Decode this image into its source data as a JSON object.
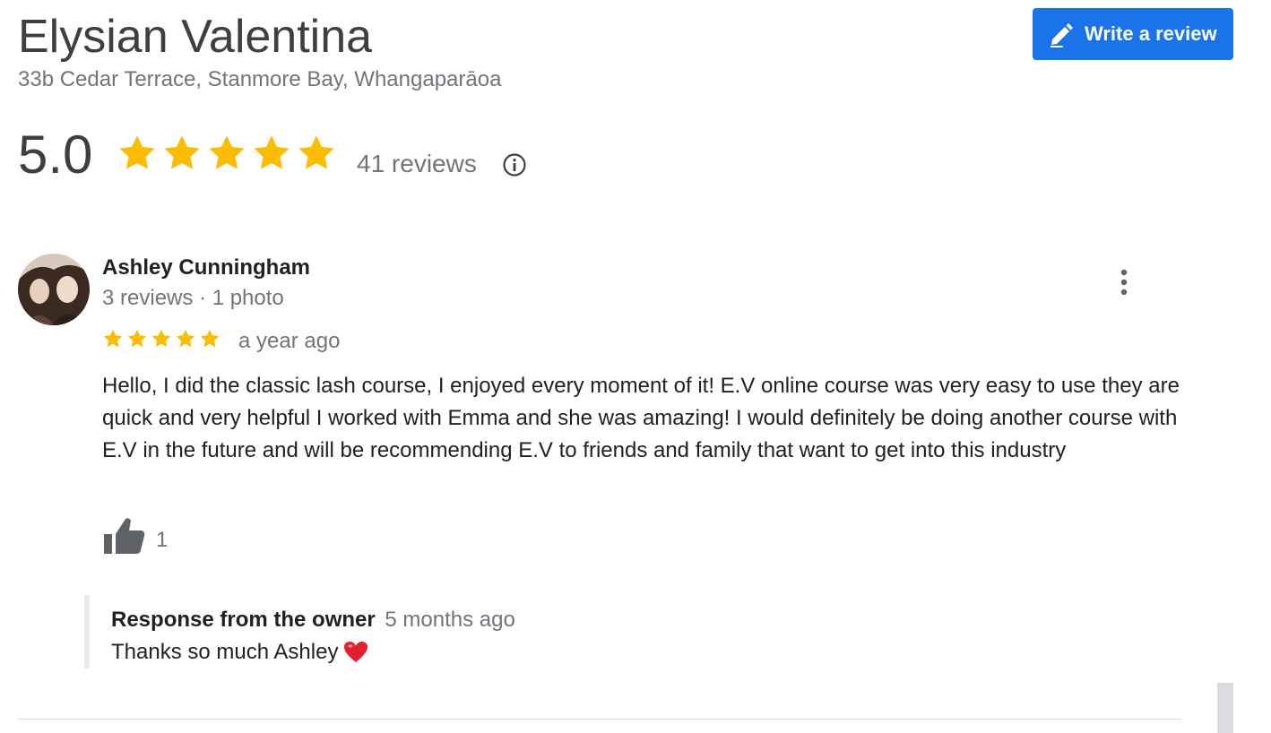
{
  "business": {
    "name": "Elysian Valentina",
    "address": "33b Cedar Terrace, Stanmore Bay, Whangaparāoa"
  },
  "actions": {
    "write_review_label": "Write a review",
    "write_review_icon": "pencil-icon"
  },
  "summary": {
    "rating": "5.0",
    "stars": 5,
    "review_count_label": "41 reviews",
    "star_color": "#fbbc04",
    "info_icon": "info-icon"
  },
  "review": {
    "author": "Ashley Cunningham",
    "author_meta": "3 reviews · 1 photo",
    "stars": 5,
    "time": "a year ago",
    "text": "Hello, I did the classic lash course, I enjoyed every moment of it! E.V online course was very easy to use they are quick and very helpful I worked with Emma and she was amazing! I would definitely be doing another course with E.V in the future and will be recommending E.V to friends and family that want to get into this industry",
    "likes": "1",
    "like_icon": "thumbs-up-icon",
    "more_icon": "more-vertical-icon",
    "response": {
      "label": "Response from the owner",
      "time": "5 months ago",
      "text": "Thanks so much Ashley",
      "emoji_icon": "heart-icon"
    }
  },
  "colors": {
    "accent": "#1a73e8",
    "secondary_text": "#70757a"
  }
}
